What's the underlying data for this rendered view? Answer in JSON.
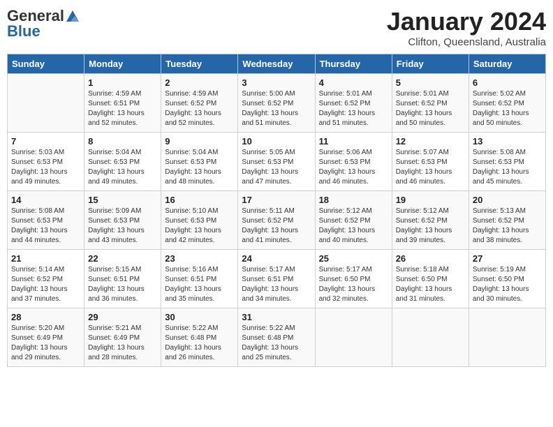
{
  "logo": {
    "general": "General",
    "blue": "Blue"
  },
  "header": {
    "month": "January 2024",
    "location": "Clifton, Queensland, Australia"
  },
  "weekdays": [
    "Sunday",
    "Monday",
    "Tuesday",
    "Wednesday",
    "Thursday",
    "Friday",
    "Saturday"
  ],
  "weeks": [
    [
      {
        "day": "",
        "sunrise": "",
        "sunset": "",
        "daylight": ""
      },
      {
        "day": "1",
        "sunrise": "Sunrise: 4:59 AM",
        "sunset": "Sunset: 6:51 PM",
        "daylight": "Daylight: 13 hours and 52 minutes."
      },
      {
        "day": "2",
        "sunrise": "Sunrise: 4:59 AM",
        "sunset": "Sunset: 6:52 PM",
        "daylight": "Daylight: 13 hours and 52 minutes."
      },
      {
        "day": "3",
        "sunrise": "Sunrise: 5:00 AM",
        "sunset": "Sunset: 6:52 PM",
        "daylight": "Daylight: 13 hours and 51 minutes."
      },
      {
        "day": "4",
        "sunrise": "Sunrise: 5:01 AM",
        "sunset": "Sunset: 6:52 PM",
        "daylight": "Daylight: 13 hours and 51 minutes."
      },
      {
        "day": "5",
        "sunrise": "Sunrise: 5:01 AM",
        "sunset": "Sunset: 6:52 PM",
        "daylight": "Daylight: 13 hours and 50 minutes."
      },
      {
        "day": "6",
        "sunrise": "Sunrise: 5:02 AM",
        "sunset": "Sunset: 6:52 PM",
        "daylight": "Daylight: 13 hours and 50 minutes."
      }
    ],
    [
      {
        "day": "7",
        "sunrise": "Sunrise: 5:03 AM",
        "sunset": "Sunset: 6:53 PM",
        "daylight": "Daylight: 13 hours and 49 minutes."
      },
      {
        "day": "8",
        "sunrise": "Sunrise: 5:04 AM",
        "sunset": "Sunset: 6:53 PM",
        "daylight": "Daylight: 13 hours and 49 minutes."
      },
      {
        "day": "9",
        "sunrise": "Sunrise: 5:04 AM",
        "sunset": "Sunset: 6:53 PM",
        "daylight": "Daylight: 13 hours and 48 minutes."
      },
      {
        "day": "10",
        "sunrise": "Sunrise: 5:05 AM",
        "sunset": "Sunset: 6:53 PM",
        "daylight": "Daylight: 13 hours and 47 minutes."
      },
      {
        "day": "11",
        "sunrise": "Sunrise: 5:06 AM",
        "sunset": "Sunset: 6:53 PM",
        "daylight": "Daylight: 13 hours and 46 minutes."
      },
      {
        "day": "12",
        "sunrise": "Sunrise: 5:07 AM",
        "sunset": "Sunset: 6:53 PM",
        "daylight": "Daylight: 13 hours and 46 minutes."
      },
      {
        "day": "13",
        "sunrise": "Sunrise: 5:08 AM",
        "sunset": "Sunset: 6:53 PM",
        "daylight": "Daylight: 13 hours and 45 minutes."
      }
    ],
    [
      {
        "day": "14",
        "sunrise": "Sunrise: 5:08 AM",
        "sunset": "Sunset: 6:53 PM",
        "daylight": "Daylight: 13 hours and 44 minutes."
      },
      {
        "day": "15",
        "sunrise": "Sunrise: 5:09 AM",
        "sunset": "Sunset: 6:53 PM",
        "daylight": "Daylight: 13 hours and 43 minutes."
      },
      {
        "day": "16",
        "sunrise": "Sunrise: 5:10 AM",
        "sunset": "Sunset: 6:53 PM",
        "daylight": "Daylight: 13 hours and 42 minutes."
      },
      {
        "day": "17",
        "sunrise": "Sunrise: 5:11 AM",
        "sunset": "Sunset: 6:52 PM",
        "daylight": "Daylight: 13 hours and 41 minutes."
      },
      {
        "day": "18",
        "sunrise": "Sunrise: 5:12 AM",
        "sunset": "Sunset: 6:52 PM",
        "daylight": "Daylight: 13 hours and 40 minutes."
      },
      {
        "day": "19",
        "sunrise": "Sunrise: 5:12 AM",
        "sunset": "Sunset: 6:52 PM",
        "daylight": "Daylight: 13 hours and 39 minutes."
      },
      {
        "day": "20",
        "sunrise": "Sunrise: 5:13 AM",
        "sunset": "Sunset: 6:52 PM",
        "daylight": "Daylight: 13 hours and 38 minutes."
      }
    ],
    [
      {
        "day": "21",
        "sunrise": "Sunrise: 5:14 AM",
        "sunset": "Sunset: 6:52 PM",
        "daylight": "Daylight: 13 hours and 37 minutes."
      },
      {
        "day": "22",
        "sunrise": "Sunrise: 5:15 AM",
        "sunset": "Sunset: 6:51 PM",
        "daylight": "Daylight: 13 hours and 36 minutes."
      },
      {
        "day": "23",
        "sunrise": "Sunrise: 5:16 AM",
        "sunset": "Sunset: 6:51 PM",
        "daylight": "Daylight: 13 hours and 35 minutes."
      },
      {
        "day": "24",
        "sunrise": "Sunrise: 5:17 AM",
        "sunset": "Sunset: 6:51 PM",
        "daylight": "Daylight: 13 hours and 34 minutes."
      },
      {
        "day": "25",
        "sunrise": "Sunrise: 5:17 AM",
        "sunset": "Sunset: 6:50 PM",
        "daylight": "Daylight: 13 hours and 32 minutes."
      },
      {
        "day": "26",
        "sunrise": "Sunrise: 5:18 AM",
        "sunset": "Sunset: 6:50 PM",
        "daylight": "Daylight: 13 hours and 31 minutes."
      },
      {
        "day": "27",
        "sunrise": "Sunrise: 5:19 AM",
        "sunset": "Sunset: 6:50 PM",
        "daylight": "Daylight: 13 hours and 30 minutes."
      }
    ],
    [
      {
        "day": "28",
        "sunrise": "Sunrise: 5:20 AM",
        "sunset": "Sunset: 6:49 PM",
        "daylight": "Daylight: 13 hours and 29 minutes."
      },
      {
        "day": "29",
        "sunrise": "Sunrise: 5:21 AM",
        "sunset": "Sunset: 6:49 PM",
        "daylight": "Daylight: 13 hours and 28 minutes."
      },
      {
        "day": "30",
        "sunrise": "Sunrise: 5:22 AM",
        "sunset": "Sunset: 6:48 PM",
        "daylight": "Daylight: 13 hours and 26 minutes."
      },
      {
        "day": "31",
        "sunrise": "Sunrise: 5:22 AM",
        "sunset": "Sunset: 6:48 PM",
        "daylight": "Daylight: 13 hours and 25 minutes."
      },
      {
        "day": "",
        "sunrise": "",
        "sunset": "",
        "daylight": ""
      },
      {
        "day": "",
        "sunrise": "",
        "sunset": "",
        "daylight": ""
      },
      {
        "day": "",
        "sunrise": "",
        "sunset": "",
        "daylight": ""
      }
    ]
  ]
}
